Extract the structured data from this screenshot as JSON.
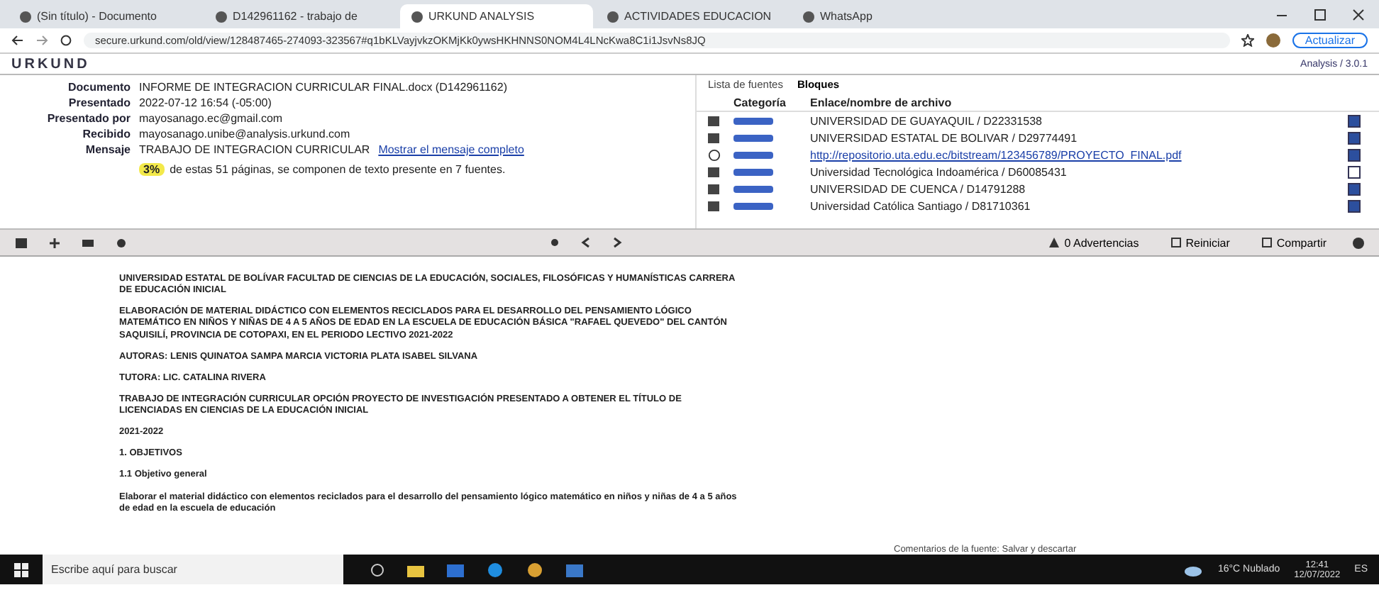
{
  "browser": {
    "tabs": [
      {
        "title": "(Sin título) - Documento",
        "selected": false
      },
      {
        "title": "D142961162 - trabajo de",
        "selected": false
      },
      {
        "title": "URKUND ANALYSIS",
        "selected": true
      },
      {
        "title": "ACTIVIDADES EDUCACION",
        "selected": false
      },
      {
        "title": "WhatsApp",
        "selected": false
      }
    ],
    "url": "secure.urkund.com/old/view/128487465-274093-323567#q1bKLVayjvkzOKMjKk0ywsHKHNNS0NOM4L4LNcKwa8C1i1JsvNs8JQ",
    "profile_button": "Actualizar"
  },
  "urkund": {
    "logo": "URKUND",
    "user": "Analysis / 3.0.1",
    "meta": [
      {
        "label": "Documento",
        "value": "INFORME DE INTEGRACION CURRICULAR FINAL.docx",
        "extra": "(D142961162)"
      },
      {
        "label": "Presentado",
        "value": "2022-07-12 16:54 (-05:00)"
      },
      {
        "label": "Presentado por",
        "value": "mayosanago.ec@gmail.com"
      },
      {
        "label": "Recibido",
        "value": "mayosanago.unibe@analysis.urkund.com"
      },
      {
        "label": "Mensaje",
        "value": "TRABAJO DE INTEGRACION CURRICULAR",
        "link": "Mostrar el mensaje completo"
      }
    ],
    "score": "3%",
    "score_text": "de estas 51 páginas, se componen de texto presente en 7 fuentes."
  },
  "sources": {
    "tabs": [
      {
        "label": "Lista de fuentes",
        "selected": false
      },
      {
        "label": "Bloques",
        "selected": true
      }
    ],
    "columns": [
      "Categoría",
      "Enlace/nombre de archivo"
    ],
    "rows": [
      {
        "name": "UNIVERSIDAD DE GUAYAQUIL / D22331538",
        "kind": "file",
        "checked": true
      },
      {
        "name": "UNIVERSIDAD ESTATAL DE BOLIVAR / D29774491",
        "kind": "file",
        "checked": true
      },
      {
        "name": "http://repositorio.uta.edu.ec/bitstream/123456789/PROYECTO_FINAL.pdf",
        "kind": "link",
        "checked": true
      },
      {
        "name": "Universidad Tecnológica Indoamérica / D60085431",
        "kind": "file",
        "checked": false
      },
      {
        "name": "UNIVERSIDAD DE CUENCA / D14791288",
        "kind": "file",
        "checked": true
      },
      {
        "name": "Universidad Católica Santiago / D81710361",
        "kind": "file",
        "checked": true
      }
    ]
  },
  "toolbar": {
    "actions": [
      "0 Advertencias",
      "Reiniciar",
      "Compartir"
    ]
  },
  "document": {
    "paragraphs": [
      "UNIVERSIDAD ESTATAL DE BOLÍVAR FACULTAD DE CIENCIAS DE LA EDUCACIÓN, SOCIALES, FILOSÓFICAS Y HUMANÍSTICAS CARRERA DE EDUCACIÓN INICIAL",
      "ELABORACIÓN DE MATERIAL DIDÁCTICO CON ELEMENTOS RECICLADOS PARA EL DESARROLLO DEL PENSAMIENTO LÓGICO MATEMÁTICO EN NIÑOS Y NIÑAS DE 4 A 5 AÑOS DE EDAD EN LA ESCUELA DE EDUCACIÓN BÁSICA \"RAFAEL QUEVEDO\" DEL CANTÓN SAQUISILÍ, PROVINCIA DE COTOPAXI, EN EL PERIODO LECTIVO 2021-2022",
      "AUTORAS: LENIS QUINATOA SAMPA MARCIA VICTORIA PLATA ISABEL SILVANA",
      "TUTORA: LIC. CATALINA RIVERA",
      "TRABAJO DE INTEGRACIÓN CURRICULAR OPCIÓN PROYECTO DE INVESTIGACIÓN PRESENTADO A OBTENER EL TÍTULO DE LICENCIADAS EN CIENCIAS DE LA EDUCACIÓN INICIAL",
      "2021-2022",
      "1. OBJETIVOS",
      "1.1 Objetivo general",
      "Elaborar el material didáctico con elementos reciclados para el desarrollo del pensamiento lógico matemático en niños y niñas de 4 a 5 años de edad en la escuela de educación"
    ],
    "side_note": "Comentarios de la fuente: Salvar y descartar"
  },
  "taskbar": {
    "search_placeholder": "Escribe aquí para buscar",
    "weather": "16°C Nublado",
    "time": "12:41",
    "date": "12/07/2022",
    "lang": "ES"
  }
}
